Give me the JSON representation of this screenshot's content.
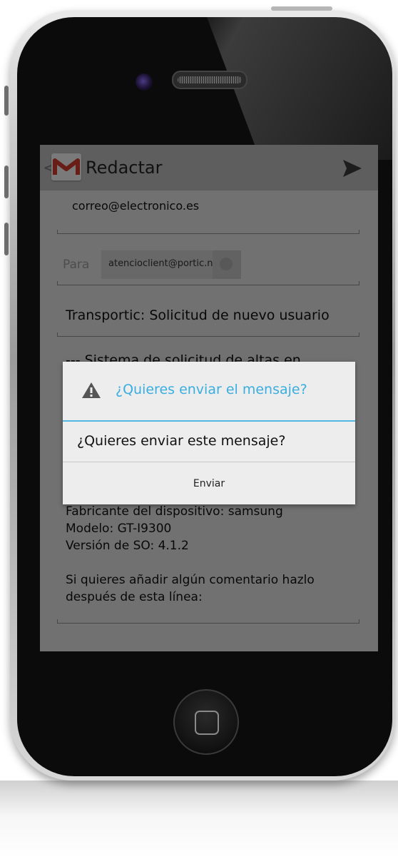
{
  "action_bar": {
    "title": "Redactar",
    "back_glyph": "<",
    "app_icon": "gmail-icon",
    "send_icon": "send-icon"
  },
  "compose": {
    "from": "correo@electronico.es",
    "to_label": "Para",
    "to_recipient": "atencioclient@portic.net",
    "subject": "Transportic: Solicitud de nuevo usuario",
    "body_partial_first_line": "--- Sistema de solicitud de altas en",
    "body_lines": [
      "Fabricante del dispositivo: samsung",
      "Modelo: GT-I9300",
      "Versión de SO: 4.1.2",
      "",
      "Si quieres añadir algún comentario hazlo",
      "después de esta línea:"
    ]
  },
  "dialog": {
    "title": "¿Quieres enviar el mensaje?",
    "message": "¿Quieres enviar este mensaje?",
    "button": "Enviar",
    "icon": "warning-icon",
    "accent_color": "#3aaee0"
  }
}
